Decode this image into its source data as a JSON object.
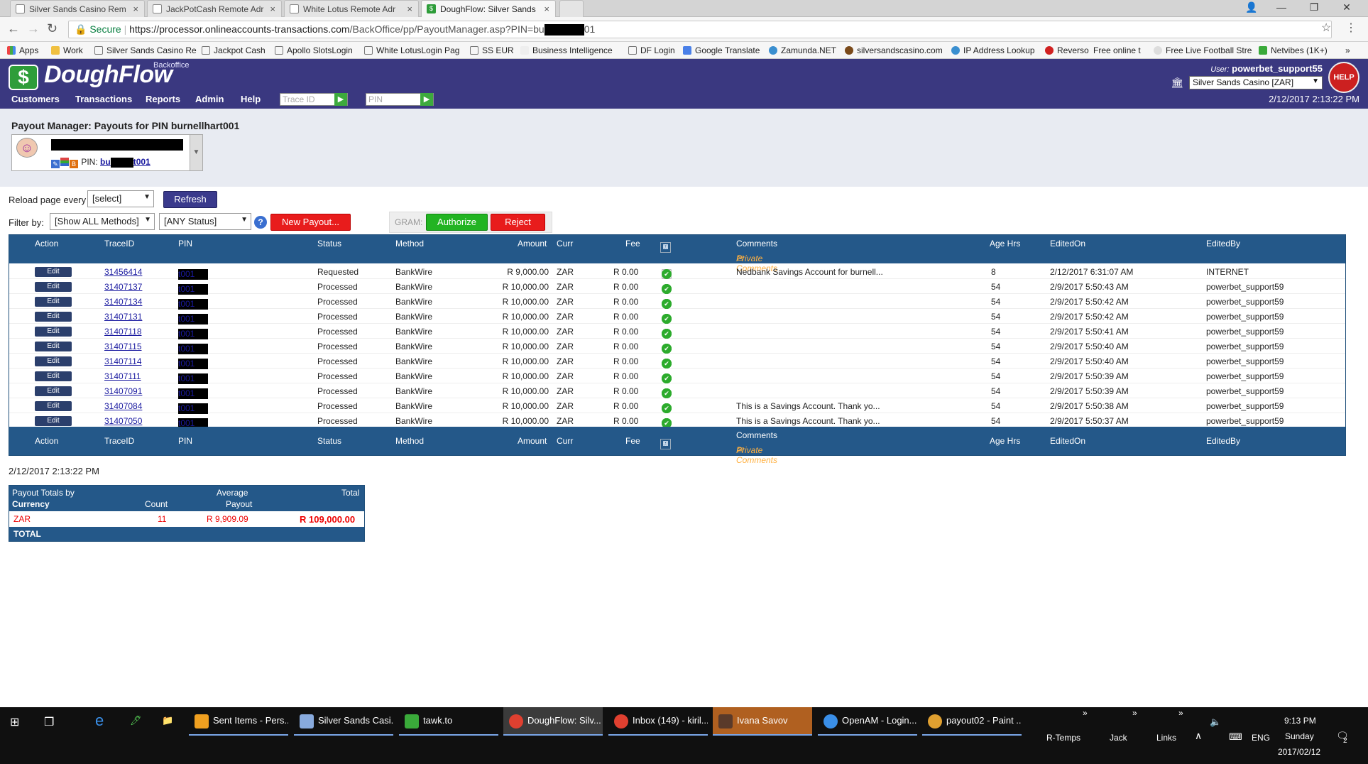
{
  "browser": {
    "tabs": [
      {
        "label": "Silver Sands Casino Rem",
        "icon": "page-icon"
      },
      {
        "label": "JackPotCash Remote Adr",
        "icon": "page-icon"
      },
      {
        "label": "White Lotus Remote Adr",
        "icon": "page-icon"
      },
      {
        "label": "DoughFlow: Silver Sands",
        "icon": "doughflow-icon"
      }
    ],
    "secure_label": "Secure",
    "url_prefix": "https://processor.onlineaccounts-transactions.com",
    "url_path": "/BackOffice/pp/PayoutManager.asp?PIN=bu",
    "url_suffix": "01",
    "bookmarks": [
      "Apps",
      "Work",
      "Silver Sands Casino Re",
      "Jackpot Cash",
      "Apollo SlotsLogin",
      "White LotusLogin Pag",
      "SS EUR",
      "Business Intelligence",
      "DF Login",
      "Google Translate",
      "Zamunda.NET",
      "silversandscasino.com",
      "IP Address Lookup",
      "Reverso",
      "Free online t",
      "Free Live Football Stre",
      "Netvibes (1K+)"
    ]
  },
  "header": {
    "logo": "DoughFlow",
    "logo_sub": "Backoffice",
    "nav": [
      "Customers",
      "Transactions",
      "Reports",
      "Admin",
      "Help"
    ],
    "trace_placeholder": "Trace ID",
    "pin_placeholder": "PIN",
    "user_label": "User:",
    "user": "powerbet_support55",
    "casino": "Silver Sands Casino [ZAR]",
    "help": "HELP",
    "datetime": "2/12/2017 2:13:22 PM"
  },
  "page": {
    "title": "Payout Manager: Payouts for PIN burnellhart001",
    "pin_label": "PIN:",
    "pin_start": "bu",
    "pin_end": "t001",
    "reload_label": "Reload page every",
    "reload_value": "[select]",
    "refresh": "Refresh",
    "filter_label": "Filter by:",
    "method_filter": "[Show ALL Methods]",
    "status_filter": "[ANY Status]",
    "new_payout": "New Payout...",
    "gram_label": "GRAM:",
    "authorize": "Authorize",
    "reject": "Reject"
  },
  "grid": {
    "columns": {
      "action": "Action",
      "traceid": "TraceID",
      "pin": "PIN",
      "status": "Status",
      "method": "Method",
      "amount": "Amount",
      "curr": "Curr",
      "fee": "Fee",
      "gram": [
        "G",
        "R",
        "A",
        "M"
      ],
      "comments": "Comments",
      "private": "Private Comments",
      "age": "Age Hrs",
      "editedon": "EditedOn",
      "editedby": "EditedBy"
    },
    "edit_label": "Edit",
    "rows": [
      {
        "trace": "31456414",
        "pin_a": "bu",
        "pin_b": "t001",
        "status": "Requested",
        "method": "BankWire",
        "amount": "R 9,000.00",
        "curr": "ZAR",
        "fee": "R 0.00",
        "gram": [
          0,
          0,
          0,
          1
        ],
        "comment": "Nedbank Savings Account for burnell...",
        "age": "8",
        "editedon": "2/12/2017 6:31:07 AM",
        "editedby": "INTERNET"
      },
      {
        "trace": "31407137",
        "pin_a": "bu",
        "pin_b": "t001",
        "status": "Processed",
        "method": "BankWire",
        "amount": "R 10,000.00",
        "curr": "ZAR",
        "fee": "R 0.00",
        "gram": [
          1,
          1,
          1,
          1
        ],
        "comment": "",
        "age": "54",
        "editedon": "2/9/2017 5:50:43 AM",
        "editedby": "powerbet_support59"
      },
      {
        "trace": "31407134",
        "pin_a": "bu",
        "pin_b": "t001",
        "status": "Processed",
        "method": "BankWire",
        "amount": "R 10,000.00",
        "curr": "ZAR",
        "fee": "R 0.00",
        "gram": [
          1,
          1,
          1,
          1
        ],
        "comment": "",
        "age": "54",
        "editedon": "2/9/2017 5:50:42 AM",
        "editedby": "powerbet_support59"
      },
      {
        "trace": "31407131",
        "pin_a": "bu",
        "pin_b": "t001",
        "status": "Processed",
        "method": "BankWire",
        "amount": "R 10,000.00",
        "curr": "ZAR",
        "fee": "R 0.00",
        "gram": [
          1,
          1,
          1,
          1
        ],
        "comment": "",
        "age": "54",
        "editedon": "2/9/2017 5:50:42 AM",
        "editedby": "powerbet_support59"
      },
      {
        "trace": "31407118",
        "pin_a": "bu",
        "pin_b": "t001",
        "status": "Processed",
        "method": "BankWire",
        "amount": "R 10,000.00",
        "curr": "ZAR",
        "fee": "R 0.00",
        "gram": [
          1,
          1,
          1,
          1
        ],
        "comment": "",
        "age": "54",
        "editedon": "2/9/2017 5:50:41 AM",
        "editedby": "powerbet_support59"
      },
      {
        "trace": "31407115",
        "pin_a": "bu",
        "pin_b": "t001",
        "status": "Processed",
        "method": "BankWire",
        "amount": "R 10,000.00",
        "curr": "ZAR",
        "fee": "R 0.00",
        "gram": [
          1,
          1,
          1,
          1
        ],
        "comment": "",
        "age": "54",
        "editedon": "2/9/2017 5:50:40 AM",
        "editedby": "powerbet_support59"
      },
      {
        "trace": "31407114",
        "pin_a": "bu",
        "pin_b": "t001",
        "status": "Processed",
        "method": "BankWire",
        "amount": "R 10,000.00",
        "curr": "ZAR",
        "fee": "R 0.00",
        "gram": [
          1,
          1,
          1,
          1
        ],
        "comment": "",
        "age": "54",
        "editedon": "2/9/2017 5:50:40 AM",
        "editedby": "powerbet_support59"
      },
      {
        "trace": "31407111",
        "pin_a": "bu",
        "pin_b": "t001",
        "status": "Processed",
        "method": "BankWire",
        "amount": "R 10,000.00",
        "curr": "ZAR",
        "fee": "R 0.00",
        "gram": [
          1,
          1,
          1,
          1
        ],
        "comment": "",
        "age": "54",
        "editedon": "2/9/2017 5:50:39 AM",
        "editedby": "powerbet_support59"
      },
      {
        "trace": "31407091",
        "pin_a": "bu",
        "pin_b": "t001",
        "status": "Processed",
        "method": "BankWire",
        "amount": "R 10,000.00",
        "curr": "ZAR",
        "fee": "R 0.00",
        "gram": [
          1,
          1,
          1,
          1
        ],
        "comment": "",
        "age": "54",
        "editedon": "2/9/2017 5:50:39 AM",
        "editedby": "powerbet_support59"
      },
      {
        "trace": "31407084",
        "pin_a": "bu",
        "pin_b": "t001",
        "status": "Processed",
        "method": "BankWire",
        "amount": "R 10,000.00",
        "curr": "ZAR",
        "fee": "R 0.00",
        "gram": [
          1,
          1,
          1,
          1
        ],
        "comment": "This is a Savings Account. Thank yo...",
        "age": "54",
        "editedon": "2/9/2017 5:50:38 AM",
        "editedby": "powerbet_support59"
      },
      {
        "trace": "31407050",
        "pin_a": "bu",
        "pin_b": "t001",
        "status": "Processed",
        "method": "BankWire",
        "amount": "R 10,000.00",
        "curr": "ZAR",
        "fee": "R 0.00",
        "gram": [
          1,
          1,
          1,
          1
        ],
        "comment": "This is a Savings Account. Thank yo...",
        "age": "54",
        "editedon": "2/9/2017 5:50:37 AM",
        "editedby": "powerbet_support59"
      }
    ]
  },
  "totals": {
    "timestamp": "2/12/2017 2:13:22 PM",
    "h_title1": "Payout Totals by",
    "h_title2": "Currency",
    "h_count": "Count",
    "h_avg1": "Average",
    "h_avg2": "Payout",
    "h_total": "Total",
    "currency": "ZAR",
    "count": "11",
    "average": "R 9,909.09",
    "total": "R 109,000.00",
    "footer": "TOTAL"
  },
  "taskbar": {
    "items": [
      "Sent Items - Pers...",
      "Silver Sands Casi...",
      "tawk.to",
      "DoughFlow: Silv...",
      "Inbox (149) - kiril...",
      "Ivana Savov",
      "OpenAM - Login...",
      "payout02 - Paint ..."
    ],
    "toolbars": [
      "R-Temps",
      "Jack",
      "Links"
    ],
    "lang": "ENG",
    "time": "9:13 PM",
    "day": "Sunday",
    "date": "2017/02/12",
    "notif": "2"
  }
}
